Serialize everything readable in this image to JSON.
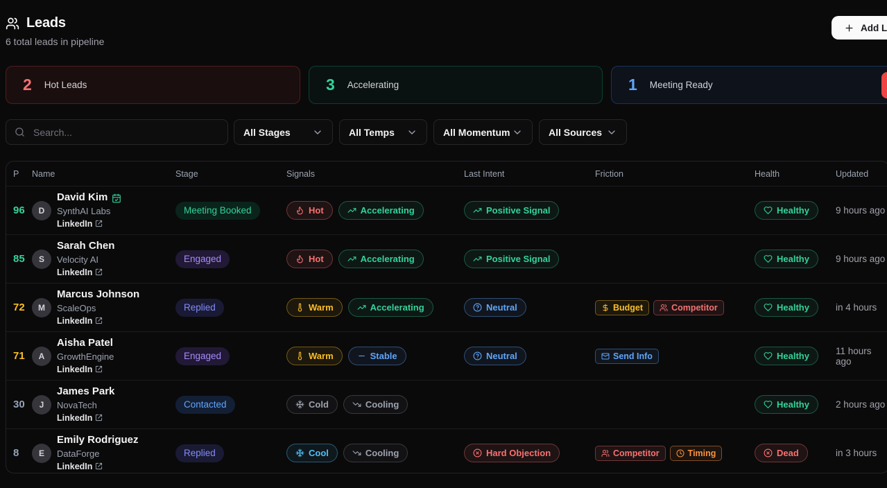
{
  "header": {
    "title": "Leads",
    "subtitle": "6 total leads in pipeline",
    "add_button": "Add Lead"
  },
  "stats": [
    {
      "value": "2",
      "label": "Hot Leads",
      "theme": "red"
    },
    {
      "value": "3",
      "label": "Accelerating",
      "theme": "green"
    },
    {
      "value": "1",
      "label": "Meeting Ready",
      "theme": "blue"
    }
  ],
  "filters": {
    "search_placeholder": "Search...",
    "dropdowns": [
      "All Stages",
      "All Temps",
      "All Momentum",
      "All Sources"
    ]
  },
  "table": {
    "columns": [
      "P",
      "Name",
      "Stage",
      "Signals",
      "Last Intent",
      "Friction",
      "Health",
      "Updated"
    ],
    "linkedin_label": "LinkedIn",
    "rows": [
      {
        "score": "96",
        "score_theme": "green",
        "avatar": "D",
        "name": "David Kim",
        "meeting_booked_icon": true,
        "company": "SynthAI Labs",
        "stage": {
          "label": "Meeting Booked",
          "theme": "green"
        },
        "signals": [
          {
            "label": "Hot",
            "icon": "flame",
            "theme": "red"
          },
          {
            "label": "Accelerating",
            "icon": "trending-up",
            "theme": "green"
          }
        ],
        "last_intent": {
          "label": "Positive Signal",
          "icon": "trending-up",
          "theme": "green"
        },
        "friction": [],
        "health": {
          "label": "Healthy",
          "icon": "heart",
          "theme": "green"
        },
        "updated": "9 hours ago"
      },
      {
        "score": "85",
        "score_theme": "green",
        "avatar": "S",
        "name": "Sarah Chen",
        "meeting_booked_icon": false,
        "company": "Velocity AI",
        "stage": {
          "label": "Engaged",
          "theme": "purple"
        },
        "signals": [
          {
            "label": "Hot",
            "icon": "flame",
            "theme": "red"
          },
          {
            "label": "Accelerating",
            "icon": "trending-up",
            "theme": "green"
          }
        ],
        "last_intent": {
          "label": "Positive Signal",
          "icon": "trending-up",
          "theme": "green"
        },
        "friction": [],
        "health": {
          "label": "Healthy",
          "icon": "heart",
          "theme": "green"
        },
        "updated": "9 hours ago"
      },
      {
        "score": "72",
        "score_theme": "amber",
        "avatar": "M",
        "name": "Marcus Johnson",
        "meeting_booked_icon": false,
        "company": "ScaleOps",
        "stage": {
          "label": "Replied",
          "theme": "indigo"
        },
        "signals": [
          {
            "label": "Warm",
            "icon": "thermometer",
            "theme": "amber"
          },
          {
            "label": "Accelerating",
            "icon": "trending-up",
            "theme": "green"
          }
        ],
        "last_intent": {
          "label": "Neutral",
          "icon": "help-circle",
          "theme": "blue"
        },
        "friction": [
          {
            "label": "Budget",
            "icon": "dollar",
            "theme": "amber"
          },
          {
            "label": "Competitor",
            "icon": "users",
            "theme": "red"
          }
        ],
        "health": {
          "label": "Healthy",
          "icon": "heart",
          "theme": "green"
        },
        "updated": "in 4 hours"
      },
      {
        "score": "71",
        "score_theme": "amber",
        "avatar": "A",
        "name": "Aisha Patel",
        "meeting_booked_icon": false,
        "company": "GrowthEngine",
        "stage": {
          "label": "Engaged",
          "theme": "purple"
        },
        "signals": [
          {
            "label": "Warm",
            "icon": "thermometer",
            "theme": "amber"
          },
          {
            "label": "Stable",
            "icon": "minus",
            "theme": "blue"
          }
        ],
        "last_intent": {
          "label": "Neutral",
          "icon": "help-circle",
          "theme": "blue"
        },
        "friction": [
          {
            "label": "Send Info",
            "icon": "mail",
            "theme": "blue"
          }
        ],
        "health": {
          "label": "Healthy",
          "icon": "heart",
          "theme": "green"
        },
        "updated": "11 hours ago"
      },
      {
        "score": "30",
        "score_theme": "slate",
        "avatar": "J",
        "name": "James Park",
        "meeting_booked_icon": false,
        "company": "NovaTech",
        "stage": {
          "label": "Contacted",
          "theme": "blue"
        },
        "signals": [
          {
            "label": "Cold",
            "icon": "snowflake",
            "theme": "gray"
          },
          {
            "label": "Cooling",
            "icon": "trending-down",
            "theme": "gray"
          }
        ],
        "last_intent": null,
        "friction": [],
        "health": {
          "label": "Healthy",
          "icon": "heart",
          "theme": "green"
        },
        "updated": "2 hours ago"
      },
      {
        "score": "8",
        "score_theme": "slate",
        "avatar": "E",
        "name": "Emily Rodriguez",
        "meeting_booked_icon": false,
        "company": "DataForge",
        "stage": {
          "label": "Replied",
          "theme": "indigo"
        },
        "signals": [
          {
            "label": "Cool",
            "icon": "snowflake",
            "theme": "sky"
          },
          {
            "label": "Cooling",
            "icon": "trending-down",
            "theme": "gray"
          }
        ],
        "last_intent": {
          "label": "Hard Objection",
          "icon": "circle-x",
          "theme": "red"
        },
        "friction": [
          {
            "label": "Competitor",
            "icon": "users",
            "theme": "red"
          },
          {
            "label": "Timing",
            "icon": "clock",
            "theme": "orange"
          }
        ],
        "health": {
          "label": "Dead",
          "icon": "circle-x",
          "theme": "red"
        },
        "updated": "in 3 hours"
      }
    ]
  },
  "palette": {
    "red": "#f87171",
    "green": "#34d399",
    "amber": "#fbbf24",
    "blue": "#60a5fa",
    "purple": "#a78bfa",
    "indigo": "#818cf8",
    "gray": "#9ca3af",
    "sky": "#4fc0f8",
    "orange": "#fb923c",
    "slate": "#94a3b8",
    "bright_red": "#ef4444",
    "background": "#0a0a0b",
    "card_border": "#232329",
    "button_bg": "#fafafa"
  }
}
